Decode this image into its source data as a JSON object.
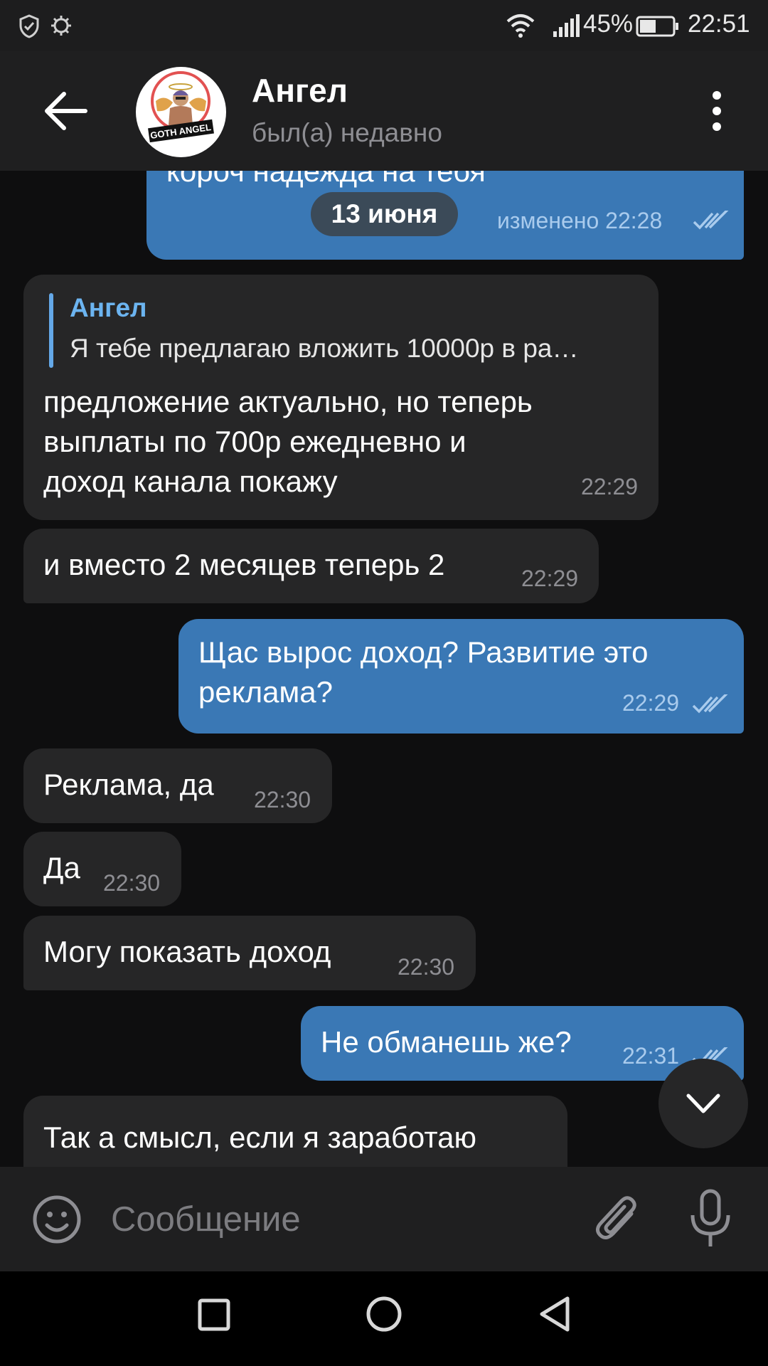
{
  "status_bar": {
    "battery": "45%",
    "time": "22:51",
    "icons": [
      "shield-icon",
      "bug-icon",
      "wifi-icon",
      "signal-icon",
      "battery-icon"
    ]
  },
  "header": {
    "name": "Ангел",
    "status": "был(а) недавно",
    "avatar_text": "GOTH ANGEL"
  },
  "chat": {
    "date_label": "13 июня",
    "messages": [
      {
        "dir": "out",
        "text": "короч надежда на тебя",
        "edited_time": "изменено 22:28"
      },
      {
        "dir": "in",
        "reply_name": "Ангел",
        "reply_text": "Я тебе предлагаю вложить 10000р в ра…",
        "lines": [
          "предложение актуально, но теперь",
          "выплаты по 700р ежедневно и",
          "доход канала покажу"
        ],
        "time": "22:29"
      },
      {
        "dir": "in",
        "text": "и вместо 2 месяцев теперь 2",
        "time": "22:29"
      },
      {
        "dir": "out",
        "lines": [
          "Щас вырос доход? Развитие это",
          "реклама?"
        ],
        "time": "22:29"
      },
      {
        "dir": "in",
        "text": "Реклама, да",
        "time": "22:30"
      },
      {
        "dir": "in",
        "text": "Да",
        "time": "22:30"
      },
      {
        "dir": "in",
        "text": "Могу показать доход",
        "time": "22:30"
      },
      {
        "dir": "out",
        "text": "Не обманешь же?",
        "time": "22:31"
      },
      {
        "dir": "in",
        "text": "Так а смысл, если я заработаю"
      }
    ]
  },
  "input": {
    "placeholder": "Сообщение"
  },
  "colors": {
    "outgoing_bubble": "#3a78b5",
    "incoming_bubble": "#262627",
    "reply_accent": "#6cb4f0"
  }
}
